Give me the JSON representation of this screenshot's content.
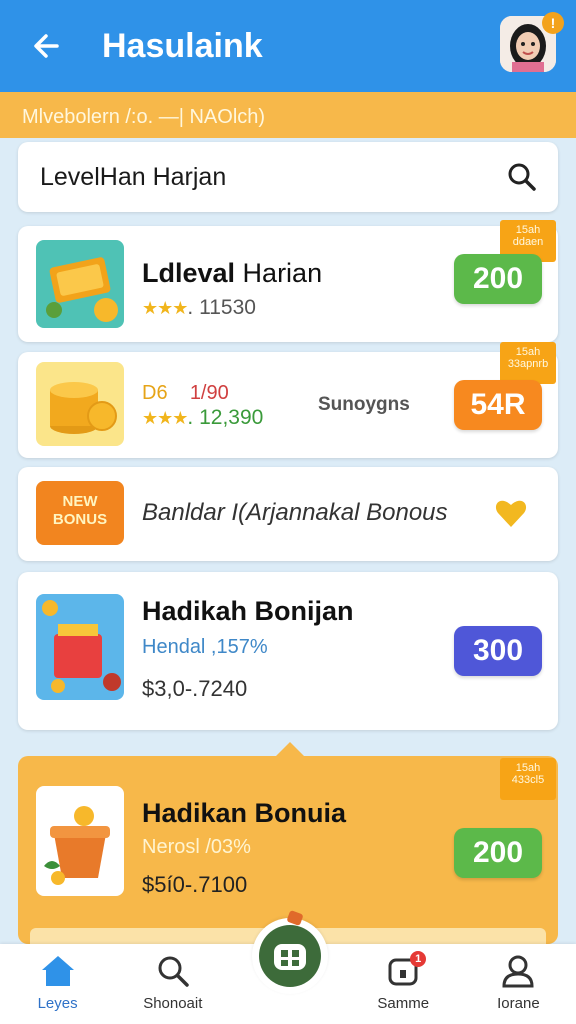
{
  "header": {
    "title": "Hasulaink",
    "avatar_badge": "!"
  },
  "breadcrumb": "Mlvebolern /:o. —| NAOlch)",
  "search": {
    "value": "LevelHan Harjan"
  },
  "cards": [
    {
      "title_bold": "Ldleval",
      "title_rest": " Harian",
      "stars": "★★★",
      "sub": ". 11530",
      "tag": "15ah ddaen",
      "amount": "200",
      "amount_color": "#5cb94a"
    },
    {
      "label_a": "D6",
      "label_b": "1/90",
      "stars": "★★★",
      "sub": ". 12,390",
      "side_text": "Sunoygns",
      "tag": "15ah 33apnrb",
      "amount": "54R",
      "amount_color": "#f7891f"
    },
    {
      "text": "Banldar I(Arjannakal Bonous",
      "thumb_text": "NEW BONUS"
    },
    {
      "title": "Hadikah Bonijan",
      "sub": "Hendal ,157%",
      "price": "$3,0-.7240",
      "amount": "300",
      "amount_color": "#4f57d8"
    },
    {
      "title": "Hadikan Bonuia",
      "sub": "Nerosl /03%",
      "price": "$5í0-.7100",
      "tag": "15ah 433cl5",
      "amount": "200",
      "amount_color": "#5cb94a"
    }
  ],
  "nav": [
    {
      "label": "Leyes",
      "icon": "home-icon",
      "active": true
    },
    {
      "label": "Shonoait",
      "icon": "search-icon"
    },
    {
      "label": "",
      "icon": "game-controller-icon"
    },
    {
      "label": "Samme",
      "icon": "chat-icon",
      "badge": "1"
    },
    {
      "label": "Iorane",
      "icon": "profile-icon"
    }
  ],
  "colors": {
    "header": "#2f92e8",
    "accent_orange": "#f7b84a",
    "green": "#5cb94a",
    "orange": "#f7891f",
    "purple": "#4f57d8"
  }
}
